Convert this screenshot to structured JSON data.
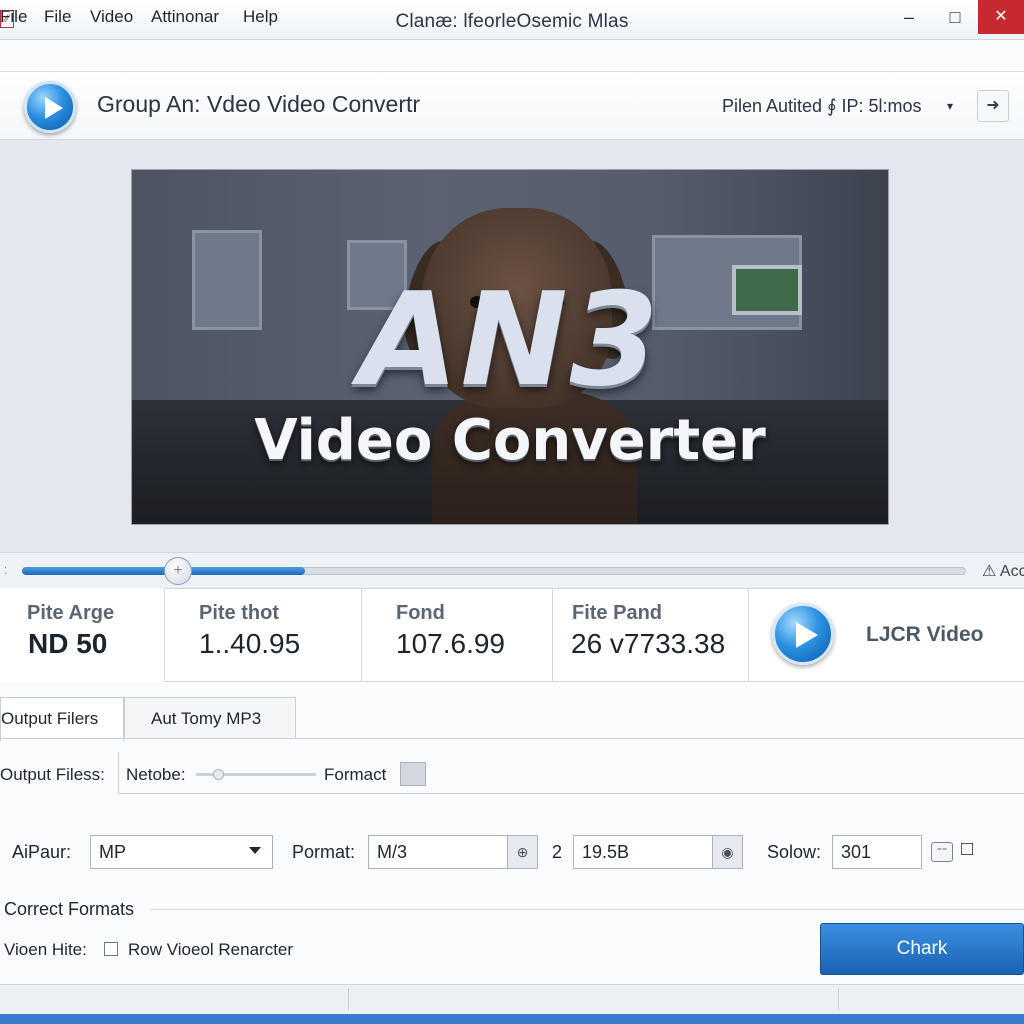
{
  "window": {
    "title": "Clanæ: lfeorleOsemic Mlas",
    "app_icon_glyph": "⁄⁄",
    "controls": {
      "minimize": "–",
      "maximize": "□",
      "close": "✕"
    }
  },
  "menu": {
    "items": [
      "File",
      "File",
      "Video",
      "Attinonar",
      "Help"
    ]
  },
  "toolbar": {
    "title": "Group  An: Vdeo  Video  Convertr",
    "right_label": "Pilen Autited  ∮  IP: 5l:mos",
    "caret": "▾",
    "action_glyph": "➜"
  },
  "preview": {
    "logo_text": "AN3",
    "subtitle": "Video  Converter"
  },
  "seekbar": {
    "progress": 0.3,
    "left_glyph": "⁚",
    "right_label": "⚠ Acc",
    "thumb_glyph": "+"
  },
  "stats": [
    {
      "label": "Pite Arge",
      "value": "ND 50"
    },
    {
      "label": "Pite thot",
      "value": "1..40.95"
    },
    {
      "label": "Fond",
      "value": "107.6.99"
    },
    {
      "label": "Fite Pand",
      "value": "26 v7733.38"
    }
  ],
  "stats_action": {
    "label": "LJCR Video"
  },
  "tabs": [
    {
      "label": "Output Filers",
      "active": true
    },
    {
      "label": "Aut Tomy MP3",
      "active": false
    }
  ],
  "output_row": {
    "files_label": "Output Filess:",
    "netobe_label": "Netobe:",
    "format_label": "Formact"
  },
  "fields_row": {
    "aipaur_label": "AiPaur:",
    "aipaur_value": "MP",
    "pormat_label": "Pormat:",
    "pormat_value": "M/3",
    "pormat_btn_glyph": "⊕",
    "number_label": "2",
    "size_value": "19.5B",
    "size_btn_glyph": "◉",
    "solow_label": "Solow:",
    "solow_value": "301",
    "icon_a_glyph": "⁼⁼",
    "icon_b_glyph": "□"
  },
  "formats": {
    "section_label": "Correct Formats",
    "viohn_label": "Vioen Hite:",
    "checkbox_label": "Row  Vioeol Renarcter",
    "checkbox_checked": false,
    "primary_button": "Chark"
  },
  "theme": {
    "accent": "#1d69bc",
    "close_red": "#c62a2f"
  }
}
